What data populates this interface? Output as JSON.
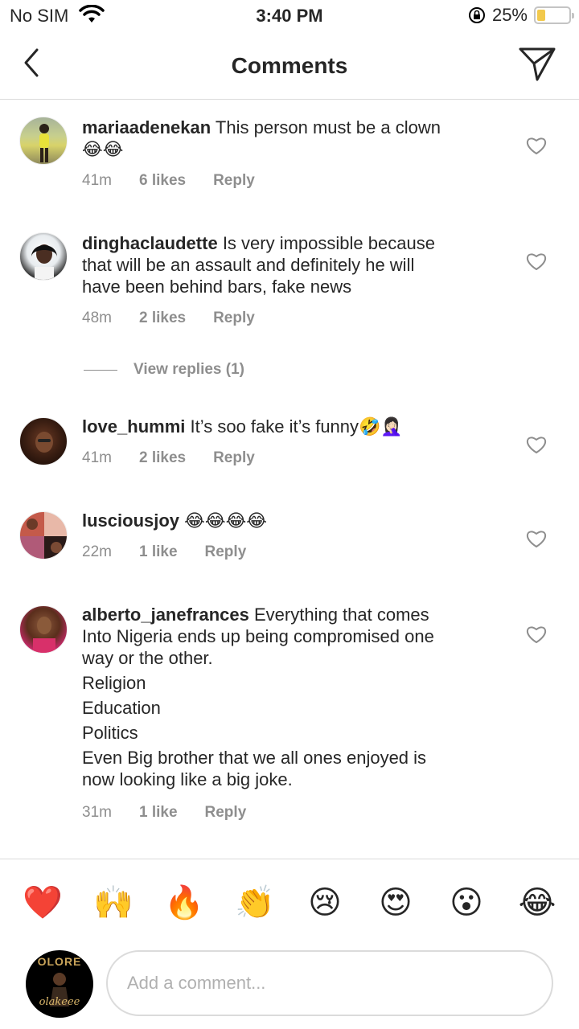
{
  "status_bar": {
    "carrier": "No SIM",
    "time": "3:40 PM",
    "battery": "25%",
    "battery_level": 0.25,
    "battery_color": "#f2c94c"
  },
  "header": {
    "title": "Comments",
    "back_icon": "chevron-left-icon",
    "send_icon": "paper-plane-icon"
  },
  "comments": [
    {
      "username": "mariaadenekan",
      "lines": [
        "This person must be a clown",
        "😂😂"
      ],
      "time": "41m",
      "likes": "6 likes",
      "reply": "Reply"
    },
    {
      "username": "dinghaclaudette",
      "lines": [
        "Is very impossible because",
        "that will be an assault and definitely he will",
        "have been behind bars, fake news"
      ],
      "time": "48m",
      "likes": "2 likes",
      "reply": "Reply"
    },
    {
      "username": "love_hummi",
      "lines": [
        "It’s soo fake it’s funny🤣🤦🏻‍♀️"
      ],
      "time": "41m",
      "likes": "2 likes",
      "reply": "Reply"
    },
    {
      "username": "lusciousjoy",
      "lines": [
        "😂😂😂😂"
      ],
      "time": "22m",
      "likes": "1 like",
      "reply": "Reply"
    },
    {
      "username": "alberto_janefrances",
      "lines": [
        "Everything that comes",
        "Into Nigeria ends up being compromised one",
        "way or the other.",
        "Religion",
        "Education",
        "Politics",
        "Even Big brother that we all ones enjoyed is",
        "now looking like a big joke."
      ],
      "time": "31m",
      "likes": "1 like",
      "reply": "Reply"
    }
  ],
  "view_replies": "View replies (1)",
  "quick_emojis": [
    "❤️",
    "🙌",
    "🔥",
    "👏",
    "😢",
    "😍",
    "😮",
    "😂"
  ],
  "composer": {
    "placeholder": "Add a comment...",
    "avatar_text": "OLORE",
    "avatar_signature": "olakeee"
  }
}
